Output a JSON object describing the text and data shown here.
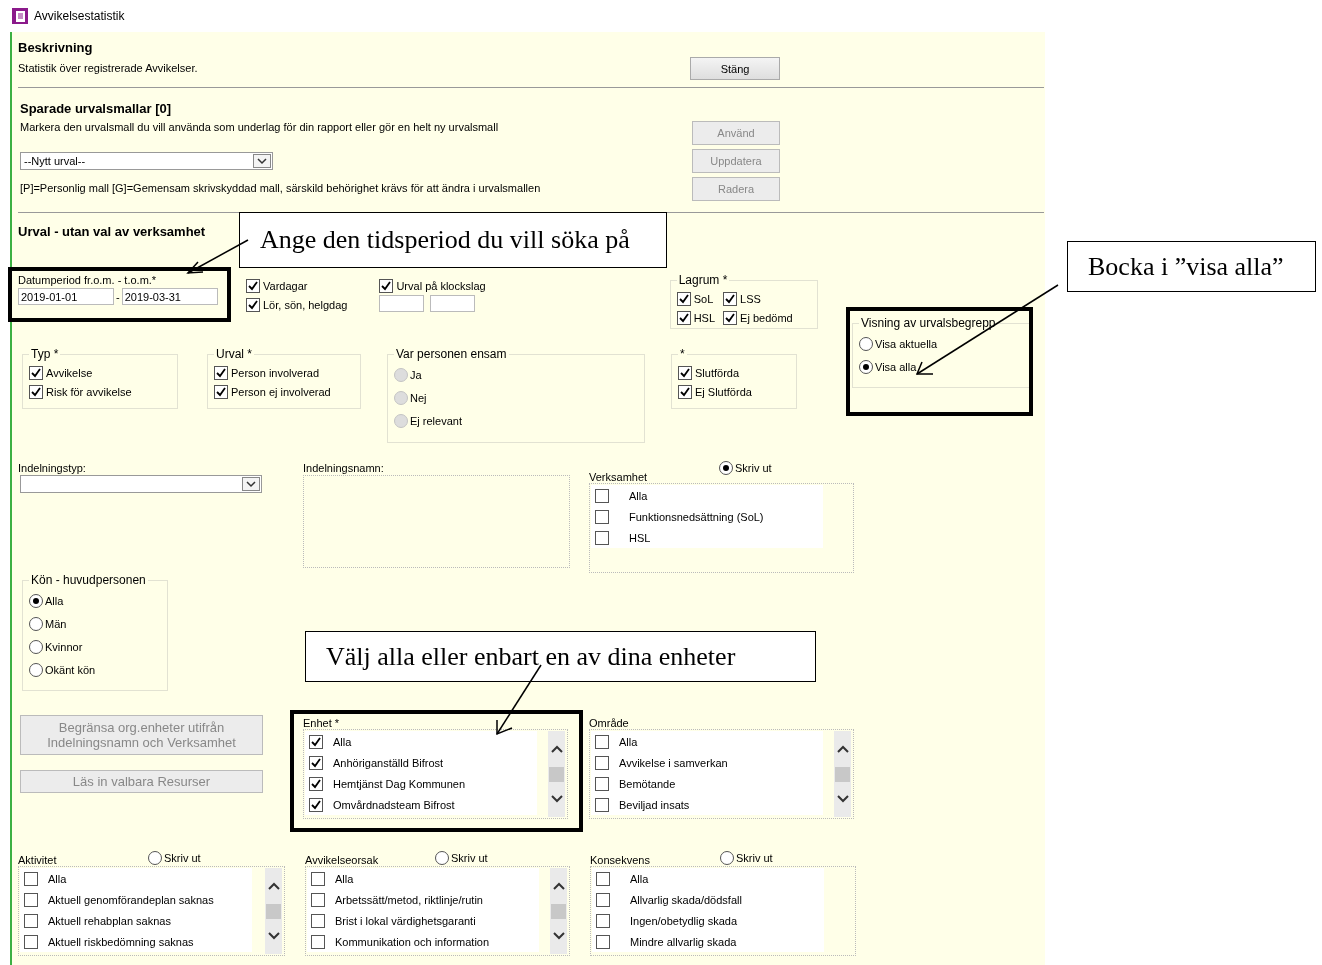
{
  "window": {
    "title": "Avvikelsestatistik"
  },
  "description": {
    "heading": "Beskrivning",
    "text": "Statistik över registrerade Avvikelser.",
    "close_button": {
      "label": "Stäng",
      "disabled": false
    }
  },
  "templates": {
    "heading": "Sparade urvalsmallar [0]",
    "text": "Markera den urvalsmall du vill använda som underlag för din rapport eller gör en helt ny urvalsmall",
    "select_value": "--Nytt urval--",
    "note": "[P]=Personlig mall [G]=Gemensam skrivskyddad mall, särskild behörighet krävs för att ändra i urvalsmallen",
    "buttons": [
      {
        "label": "Använd",
        "disabled": true
      },
      {
        "label": "Uppdatera",
        "disabled": true
      },
      {
        "label": "Radera",
        "disabled": true
      }
    ]
  },
  "selection": {
    "heading": "Urval - utan val av verksamhet",
    "date_period": {
      "label": "Datumperiod fr.o.m. - t.o.m.*",
      "from": "2019-01-01",
      "separator": "-",
      "to": "2019-03-31"
    },
    "days": [
      {
        "label": "Vardagar",
        "checked": true
      },
      {
        "label": "Lör, sön, helgdag",
        "checked": true
      }
    ],
    "time_filter": {
      "label": "Urval på klockslag",
      "checked": true
    },
    "lagrum": {
      "legend": "Lagrum *",
      "options": [
        {
          "label": "SoL",
          "checked": true
        },
        {
          "label": "LSS",
          "checked": true
        },
        {
          "label": "HSL",
          "checked": true
        },
        {
          "label": "Ej bedömd",
          "checked": true
        }
      ]
    },
    "display_mode": {
      "legend": "Visning av urvalsbegrepp",
      "options": [
        {
          "label": "Visa aktuella",
          "selected": false
        },
        {
          "label": "Visa alla",
          "selected": true
        }
      ]
    },
    "typ": {
      "legend": "Typ *",
      "options": [
        {
          "label": "Avvikelse",
          "checked": true
        },
        {
          "label": "Risk för avvikelse",
          "checked": true
        }
      ]
    },
    "urval": {
      "legend": "Urval *",
      "options": [
        {
          "label": "Person involverad",
          "checked": true
        },
        {
          "label": "Person ej involverad",
          "checked": true
        }
      ]
    },
    "alone": {
      "legend": "Var personen ensam",
      "disabled": true,
      "options": [
        {
          "label": "Ja",
          "selected": false
        },
        {
          "label": "Nej",
          "selected": false
        },
        {
          "label": "Ej relevant",
          "selected": false
        }
      ]
    },
    "status": {
      "legend": "*",
      "options": [
        {
          "label": "Slutförda",
          "checked": true
        },
        {
          "label": "Ej Slutförda",
          "checked": true
        }
      ]
    },
    "division_type": {
      "label": "Indelningstyp:"
    },
    "division_name": {
      "label": "Indelningsnamn:"
    },
    "gender": {
      "legend": "Kön - huvudpersonen",
      "options": [
        {
          "label": "Alla",
          "selected": true
        },
        {
          "label": "Män",
          "selected": false
        },
        {
          "label": "Kvinnor",
          "selected": false
        },
        {
          "label": "Okänt kön",
          "selected": false
        }
      ]
    },
    "actions": [
      {
        "label": "Begränsa org.enheter utifrån Indelningsnamn och Verksamhet",
        "disabled": true
      },
      {
        "label": "Läs in valbara Resurser",
        "disabled": true
      }
    ],
    "lists": [
      {
        "label": "Verksamhet",
        "print_option": {
          "label": "Skriv ut",
          "selected": true
        },
        "scrollable": false,
        "items": [
          {
            "label": "Alla",
            "checked": false
          },
          {
            "label": "Funktionsnedsättning (SoL)",
            "checked": false
          },
          {
            "label": "HSL",
            "checked": false
          }
        ]
      },
      {
        "label": "Enhet *",
        "scrollable": true,
        "items": [
          {
            "label": "Alla",
            "checked": true
          },
          {
            "label": "Anhöriganställd Bifrost",
            "checked": true
          },
          {
            "label": "Hemtjänst Dag Kommunen",
            "checked": true
          },
          {
            "label": "Omvårdnadsteam Bifrost",
            "checked": true
          }
        ]
      },
      {
        "label": "Område",
        "scrollable": true,
        "items": [
          {
            "label": "Alla",
            "checked": false
          },
          {
            "label": "Avvikelse i samverkan",
            "checked": false
          },
          {
            "label": "Bemötande",
            "checked": false
          },
          {
            "label": "Beviljad insats",
            "checked": false
          }
        ]
      },
      {
        "label": "Aktivitet",
        "print_option": {
          "label": "Skriv ut",
          "selected": false
        },
        "scrollable": true,
        "items": [
          {
            "label": "Alla",
            "checked": false
          },
          {
            "label": "Aktuell genomförandeplan saknas",
            "checked": false
          },
          {
            "label": "Aktuell rehabplan saknas",
            "checked": false
          },
          {
            "label": "Aktuell riskbedömning saknas",
            "checked": false
          }
        ]
      },
      {
        "label": "Avvikelseorsak",
        "print_option": {
          "label": "Skriv ut",
          "selected": false
        },
        "scrollable": true,
        "items": [
          {
            "label": "Alla",
            "checked": false
          },
          {
            "label": "Arbetssätt/metod, riktlinje/rutin",
            "checked": false
          },
          {
            "label": "Brist i lokal värdighetsgaranti",
            "checked": false
          },
          {
            "label": "Kommunikation och information",
            "checked": false
          }
        ]
      },
      {
        "label": "Konsekvens",
        "print_option": {
          "label": "Skriv ut",
          "selected": false
        },
        "scrollable": false,
        "items": [
          {
            "label": "Alla",
            "checked": false
          },
          {
            "label": "Allvarlig skada/dödsfall",
            "checked": false
          },
          {
            "label": "Ingen/obetydlig skada",
            "checked": false
          },
          {
            "label": "Mindre allvarlig skada",
            "checked": false
          }
        ]
      }
    ]
  },
  "annotations": [
    {
      "text": "Ange den tidsperiod du vill söka på"
    },
    {
      "text": "Bocka i ”visa alla”"
    },
    {
      "text": "Välj alla eller enbart en av dina enheter"
    }
  ]
}
